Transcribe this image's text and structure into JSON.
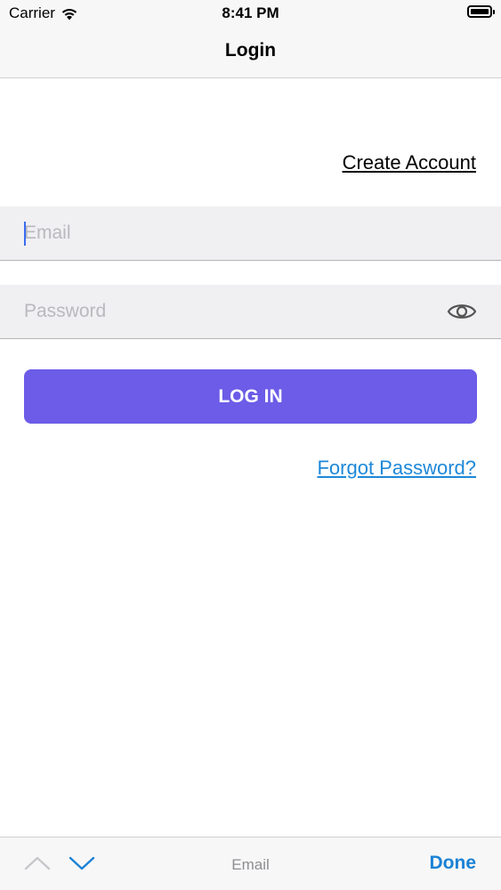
{
  "status_bar": {
    "carrier": "Carrier",
    "time": "8:41 PM",
    "wifi_icon": "wifi-icon",
    "battery_icon": "battery-icon"
  },
  "nav": {
    "title": "Login"
  },
  "create_account_label": "Create Account",
  "email": {
    "value": "",
    "placeholder": "Email"
  },
  "password": {
    "value": "",
    "placeholder": "Password",
    "toggle_icon": "eye-icon"
  },
  "login_button_label": "LOG IN",
  "forgot_password_label": "Forgot Password?",
  "toolbar": {
    "prev_icon": "chevron-up-icon",
    "next_icon": "chevron-down-icon",
    "field_label": "Email",
    "done_label": "Done"
  },
  "colors": {
    "accent": "#6c5ce7",
    "link": "#1e88d8",
    "field_background": "#f0f0f2",
    "caret": "#3b6bf0"
  }
}
